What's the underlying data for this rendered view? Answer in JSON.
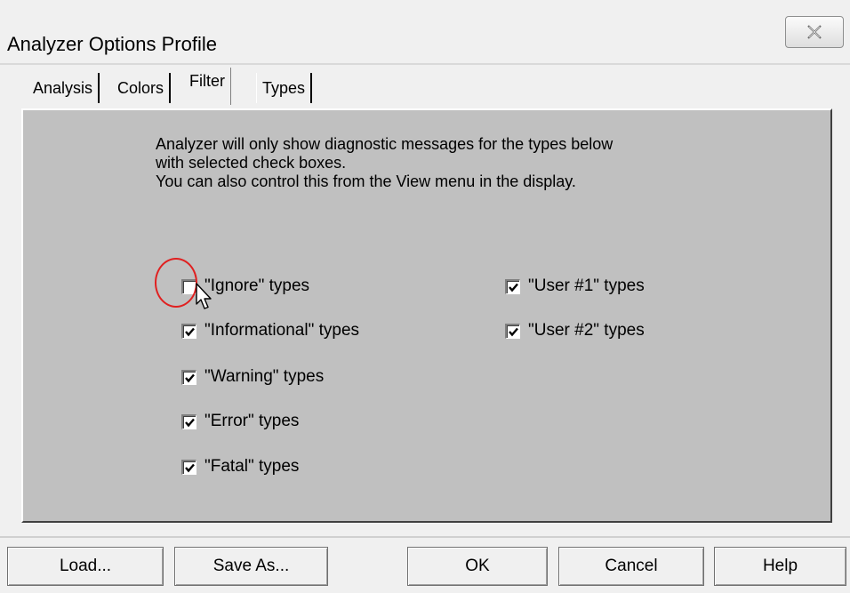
{
  "window": {
    "title": "Analyzer Options Profile"
  },
  "tabs": [
    {
      "label": "Analysis",
      "active": false
    },
    {
      "label": "Colors",
      "active": false
    },
    {
      "label": "Filter",
      "active": true
    },
    {
      "label": "Types",
      "active": false
    }
  ],
  "description": {
    "line1": "Analyzer will only show diagnostic messages for the types below",
    "line2": "with selected check boxes.",
    "line3": "You can also control this from the View menu in the display."
  },
  "checkboxes": {
    "left": [
      {
        "label": "\"Ignore\" types",
        "checked": false
      },
      {
        "label": "\"Informational\" types",
        "checked": true
      },
      {
        "label": "\"Warning\" types",
        "checked": true
      },
      {
        "label": "\"Error\" types",
        "checked": true
      },
      {
        "label": "\"Fatal\" types",
        "checked": true
      }
    ],
    "right": [
      {
        "label": "\"User #1\" types",
        "checked": true
      },
      {
        "label": "\"User #2\" types",
        "checked": true
      }
    ]
  },
  "buttons": {
    "load": "Load...",
    "save_as": "Save As...",
    "ok": "OK",
    "cancel": "Cancel",
    "help": "Help"
  },
  "icons": {
    "close": "close-icon",
    "checkmark": "checkmark-icon",
    "cursor": "mouse-pointer-icon"
  },
  "colors": {
    "panel": "#c0c0c0",
    "annotation": "#e02020"
  }
}
